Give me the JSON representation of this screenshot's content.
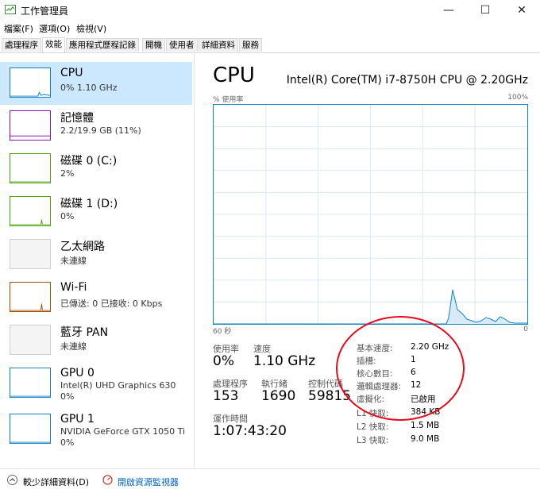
{
  "window": {
    "title": "工作管理員",
    "minimize_glyph": "—",
    "maximize_glyph": "☐",
    "close_glyph": "✕"
  },
  "menu": [
    "檔案(F)",
    "選項(O)",
    "檢視(V)"
  ],
  "tabs": [
    {
      "label": "處理程序",
      "active": false
    },
    {
      "label": "效能",
      "active": true
    },
    {
      "label": "應用程式歷程記錄",
      "active": false
    },
    {
      "label": "開機",
      "active": false
    },
    {
      "label": "使用者",
      "active": false
    },
    {
      "label": "詳細資料",
      "active": false
    },
    {
      "label": "服務",
      "active": false
    }
  ],
  "sidebar": {
    "items": [
      {
        "name": "CPU",
        "line1": "0% 1.10 GHz",
        "line2": "",
        "color": "#1181c4",
        "selected": true,
        "icon": "cpu-graph-icon"
      },
      {
        "name": "記憶體",
        "line1": "2.2/19.9 GB (11%)",
        "line2": "",
        "color": "#8b12ae",
        "selected": false,
        "icon": "memory-graph-icon"
      },
      {
        "name": "磁碟 0 (C:)",
        "line1": "2%",
        "line2": "",
        "color": "#4da60c",
        "selected": false,
        "icon": "disk-graph-icon"
      },
      {
        "name": "磁碟 1 (D:)",
        "line1": "0%",
        "line2": "",
        "color": "#4da60c",
        "selected": false,
        "icon": "disk-graph-icon"
      },
      {
        "name": "乙太網路",
        "line1": "未連線",
        "line2": "",
        "color": "#d9d9d9",
        "selected": false,
        "icon": "ethernet-graph-icon"
      },
      {
        "name": "Wi-Fi",
        "line1": "已傳送: 0 已接收: 0 Kbps",
        "line2": "",
        "color": "#a74f01",
        "selected": false,
        "icon": "wifi-graph-icon"
      },
      {
        "name": "藍牙 PAN",
        "line1": "未連線",
        "line2": "",
        "color": "#d9d9d9",
        "selected": false,
        "icon": "bluetooth-graph-icon"
      },
      {
        "name": "GPU 0",
        "line1": "Intel(R) UHD Graphics 630",
        "line2": "0%",
        "color": "#1181c4",
        "selected": false,
        "icon": "gpu-graph-icon"
      },
      {
        "name": "GPU 1",
        "line1": "NVIDIA GeForce GTX 1050 Ti",
        "line2": "0%",
        "color": "#1181c4",
        "selected": false,
        "icon": "gpu-graph-icon"
      }
    ]
  },
  "main": {
    "title": "CPU",
    "model": "Intel(R) Core(TM) i7-8750H CPU @ 2.20GHz",
    "graph_label_top_left": "% 使用率",
    "graph_label_top_right": "100%",
    "graph_label_bottom_left": "60 秒",
    "graph_label_bottom_right": "0",
    "stats": {
      "utilization_label": "使用率",
      "utilization_value": "0%",
      "speed_label": "速度",
      "speed_value": "1.10 GHz",
      "processes_label": "處理程序",
      "processes_value": "153",
      "threads_label": "執行緒",
      "threads_value": "1690",
      "handles_label": "控制代碼",
      "handles_value": "59815",
      "uptime_label": "運作時間",
      "uptime_value": "1:07:43:20"
    },
    "specs": [
      {
        "label": "基本速度:",
        "value": "2.20 GHz"
      },
      {
        "label": "插槽:",
        "value": "1"
      },
      {
        "label": "核心數目:",
        "value": "6"
      },
      {
        "label": "邏輯處理器:",
        "value": "12"
      },
      {
        "label": "虛擬化:",
        "value": "已啟用"
      },
      {
        "label": "L1 快取:",
        "value": "384 KB"
      },
      {
        "label": "L2 快取:",
        "value": "1.5 MB"
      },
      {
        "label": "L3 快取:",
        "value": "9.0 MB"
      }
    ]
  },
  "footer": {
    "fewer_details": "較少詳細資料(D)",
    "open_monitor": "開啟資源監視器"
  },
  "colors": {
    "accent": "#1181c4",
    "selected_bg": "#cce8ff",
    "annotation": "#e8091a",
    "link": "#0066cc"
  }
}
